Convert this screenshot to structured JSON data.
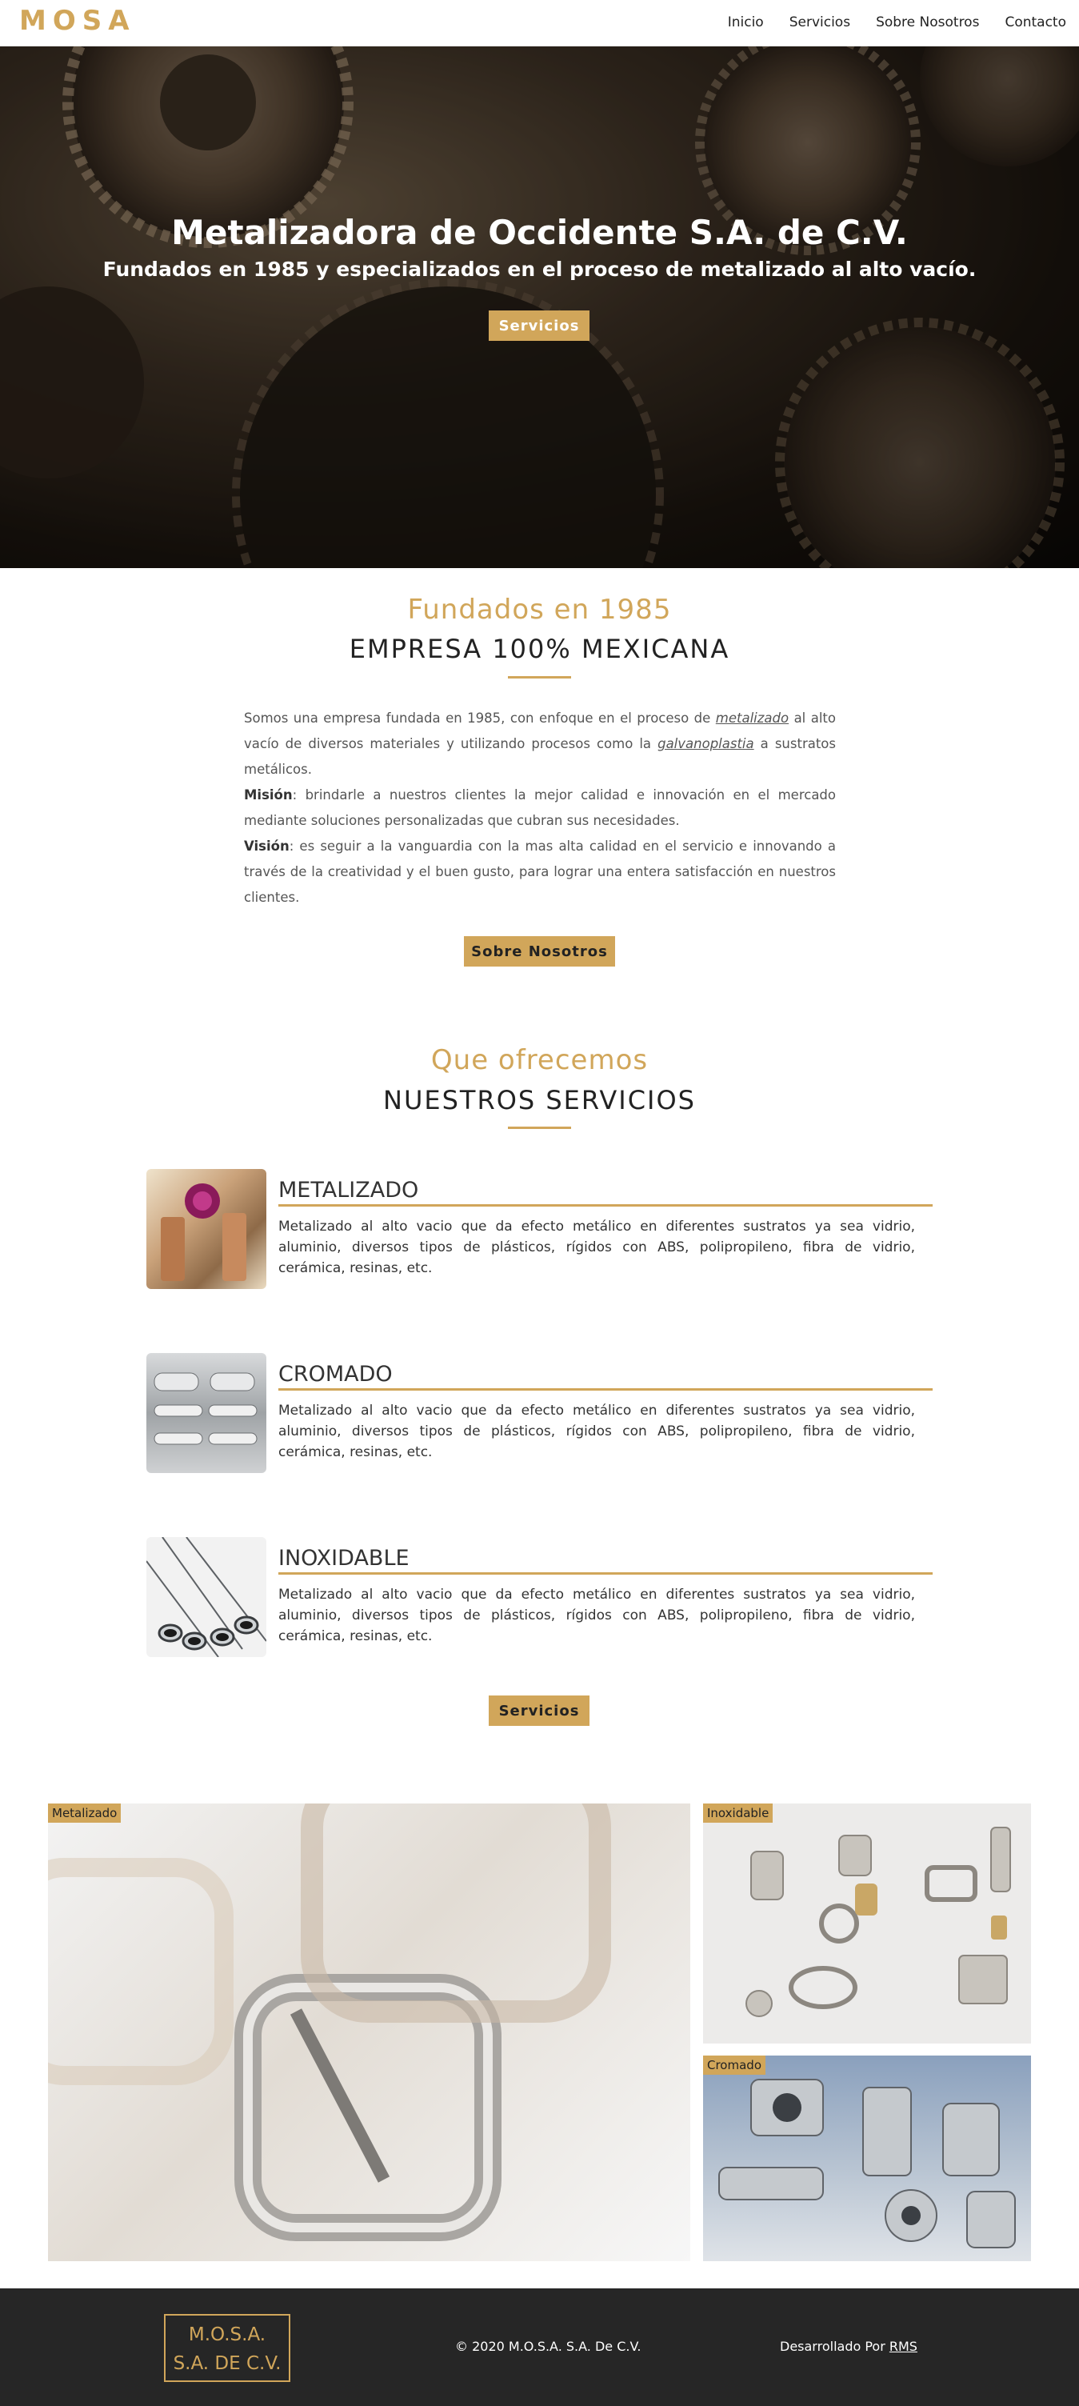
{
  "brand": {
    "logo": "MOSA",
    "accent_color": "#d1a65a"
  },
  "nav": {
    "items": [
      "Inicio",
      "Servicios",
      "Sobre Nosotros",
      "Contacto"
    ]
  },
  "hero": {
    "title": "Metalizadora de Occidente S.A. de C.V.",
    "subtitle": "Fundados en 1985 y especializados en el proceso de metalizado al alto vacío.",
    "button": "Servicios"
  },
  "about": {
    "eyebrow": "Fundados en 1985",
    "heading": "EMPRESA 100% MEXICANA",
    "intro_1": "Somos una empresa fundada en 1985, con enfoque en el proceso de ",
    "intro_link_1": "metalizado",
    "intro_2": " al alto vacío de diversos materiales y utilizando procesos como la ",
    "intro_link_2": "galvanoplastia",
    "intro_3": " a sustratos metálicos.",
    "mission_label": "Misión",
    "mission_text": ": brindarle a nuestros clientes la mejor calidad e innovación en el mercado mediante soluciones personalizadas que cubran sus necesidades.",
    "vision_label": "Visión",
    "vision_text": ": es seguir a la vanguardia con la mas alta calidad en el servicio e innovando a través de la creatividad y el buen gusto, para lograr una entera satisfacción en nuestros clientes.",
    "button": "Sobre Nosotros"
  },
  "services": {
    "eyebrow": "Que ofrecemos",
    "heading": "NUESTROS SERVICIOS",
    "items": [
      {
        "title": "METALIZADO",
        "description": "Metalizado al alto vacio que da efecto metálico en diferentes sustratos ya sea vidrio, aluminio, diversos tipos de plásticos, rígidos con ABS, polipropileno, fibra de vidrio, cerámica, resinas, etc."
      },
      {
        "title": "CROMADO",
        "description": "Metalizado al alto vacio que da efecto metálico en diferentes sustratos ya sea vidrio, aluminio, diversos tipos de plásticos, rígidos con ABS, polipropileno, fibra de vidrio, cerámica, resinas, etc."
      },
      {
        "title": "INOXIDABLE",
        "description": "Metalizado al alto vacio que da efecto metálico en diferentes sustratos ya sea vidrio, aluminio, diversos tipos de plásticos, rígidos con ABS, polipropileno, fibra de vidrio, cerámica, resinas, etc."
      }
    ],
    "button": "Servicios"
  },
  "gallery": {
    "tags": [
      "Metalizado",
      "Inoxidable",
      "Cromado"
    ]
  },
  "footer": {
    "logo_line_1": "M.O.S.A.",
    "logo_line_2": "S.A. DE C.V.",
    "copyright": "© 2020 M.O.S.A. S.A. De C.V.",
    "dev_prefix": "Desarrollado Por ",
    "dev_link": "RMS"
  }
}
